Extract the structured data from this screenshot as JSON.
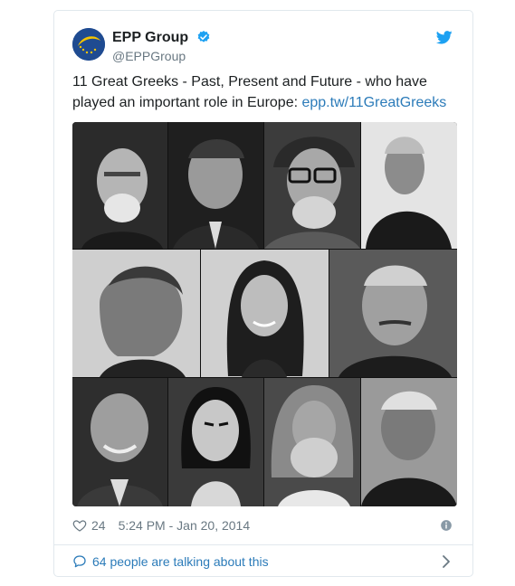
{
  "account": {
    "name": "EPP Group",
    "handle": "@EPPGroup"
  },
  "tweet": {
    "text": "11 Great Greeks - Past, Present and Future - who have played an important role in Europe: ",
    "link": "epp.tw/11GreatGreeks",
    "likes": "24",
    "timestamp": "5:24 PM - Jan 20, 2014"
  },
  "footer": {
    "talking": "64 people are talking about this"
  },
  "colors": {
    "link": "#2b7bb9",
    "muted": "#697882",
    "twitter_blue": "#1da1f2",
    "border": "#e1e8ed"
  },
  "icons": [
    "verified-badge-icon",
    "twitter-bird-icon",
    "heart-icon",
    "info-icon",
    "speech-bubble-icon",
    "chevron-right-icon"
  ],
  "photos": [
    {
      "id": "portrait-1",
      "tone": "#3a3a3a"
    },
    {
      "id": "portrait-2",
      "tone": "#2a2a2a"
    },
    {
      "id": "portrait-3",
      "tone": "#4a4a4a"
    },
    {
      "id": "portrait-4",
      "tone": "#d8d8d8"
    },
    {
      "id": "portrait-5",
      "tone": "#bdbdbd"
    },
    {
      "id": "portrait-6",
      "tone": "#1e1e1e"
    },
    {
      "id": "portrait-7",
      "tone": "#6a6a6a"
    },
    {
      "id": "portrait-8",
      "tone": "#2e2e2e"
    },
    {
      "id": "portrait-9",
      "tone": "#3c3c3c"
    },
    {
      "id": "portrait-10",
      "tone": "#5a5a5a"
    },
    {
      "id": "portrait-11",
      "tone": "#8a8a8a"
    }
  ]
}
